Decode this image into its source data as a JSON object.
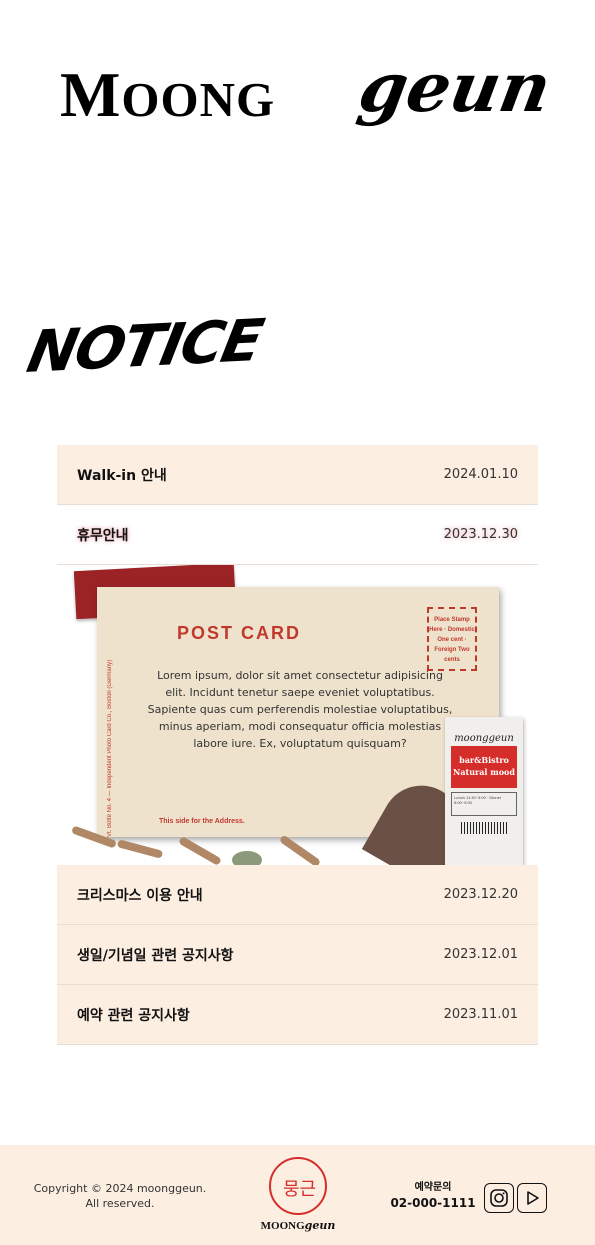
{
  "brand": {
    "logo_serif_first": "M",
    "logo_serif_rest": "OONG",
    "logo_script": "geun"
  },
  "notice": {
    "heading": "NOTICE",
    "items": [
      {
        "title": "Walk-in 안내",
        "date": "2024.01.10"
      },
      {
        "title": "휴무안내",
        "date": "2023.12.30"
      },
      {
        "title": "크리스마스 이용 안내",
        "date": "2023.12.20"
      },
      {
        "title": "생일/기념일 관련 공지사항",
        "date": "2023.12.01"
      },
      {
        "title": "예약 관련 공지사항",
        "date": "2023.11.01"
      }
    ],
    "detail": {
      "postcard_heading": "POST CARD",
      "postcard_body": "Lorem ipsum, dolor sit amet consectetur adipisicing elit. Incidunt tenetur saepe eveniet voluptatibus. Sapiente quas cum perferendis molestiae voluptatibus, minus aperiam, modi consequatur officia molestias labore iure. Ex, voluptatum quisquam?",
      "stamp_text": "Place Stamp Here · Domestic One cent · Foreign Two cents",
      "address_note": "This side for the Address.",
      "side_text": "Vt. Botte No. 4 — Independent Photo Card Co., Boston (Germany)",
      "ticket_brand": "moonggeun",
      "ticket_line1": "bar&Bistro",
      "ticket_line2": "Natural mood",
      "ticket_info": "Lunch 11:30~3:00 · Dinner 5:00~9:00"
    }
  },
  "footer": {
    "copyright_line1": "Copyright © 2024 moonggeun.",
    "copyright_line2": "All reserved.",
    "logo_mark": "뭉근",
    "logo_name_serif": "MOONG",
    "logo_name_script": "geun",
    "contact_label": "예약문의",
    "contact_phone": "02-000-1111",
    "social_icons": [
      "instagram-icon",
      "youtube-icon"
    ]
  },
  "colors": {
    "accent": "#d42d2a",
    "row_bg": "#fdeee2",
    "footer_bg": "#fdeee2"
  }
}
